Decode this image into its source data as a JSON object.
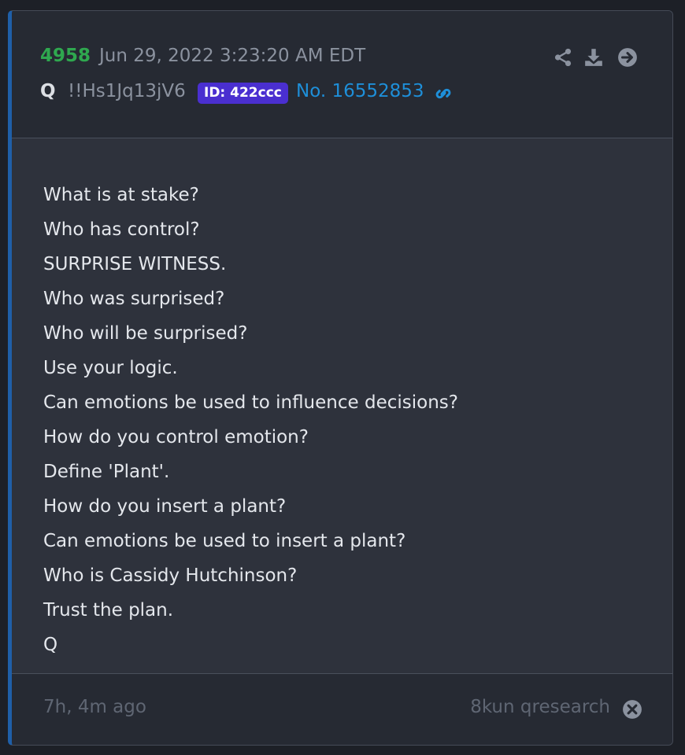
{
  "post": {
    "number": "4958",
    "date": "Jun 29, 2022 3:23:20 AM EDT",
    "author": "Q",
    "tripcode": "!!Hs1Jq13jV6",
    "id_badge": "ID: 422ccc",
    "post_no": "No. 16552853"
  },
  "header_icons": [
    "share-icon",
    "download-icon",
    "arrow-circle-right-icon"
  ],
  "lines": [
    "What is at stake?",
    "Who has control?",
    "SURPRISE WITNESS.",
    "Who was surprised?",
    "Who will be surprised?",
    "Use your logic.",
    "Can emotions be used to influence decisions?",
    "How do you control emotion?",
    "Define 'Plant'.",
    "How do you insert a plant?",
    "Can emotions be used to insert a plant?",
    "Who is Cassidy Hutchinson?",
    "Trust the plan.",
    "Q"
  ],
  "footer": {
    "age": "7h, 4m ago",
    "source": "8kun qresearch"
  },
  "colors": {
    "accent_border": "#1f5fa8",
    "post_number": "#2fa84f",
    "id_badge_bg": "#4a2fd0",
    "link": "#1e8fd9"
  }
}
